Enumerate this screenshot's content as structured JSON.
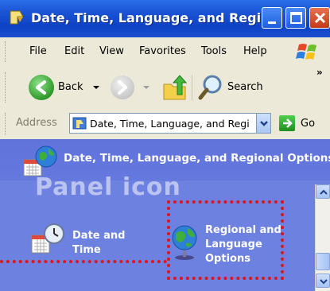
{
  "window": {
    "title": "Date, Time, Language, and Regi...",
    "controls": [
      "minimize",
      "maximize",
      "close"
    ]
  },
  "menu": {
    "items": [
      "File",
      "Edit",
      "View",
      "Favorites",
      "Tools",
      "Help"
    ]
  },
  "toolbar": {
    "back_label": "Back",
    "search_label": "Search"
  },
  "address": {
    "label": "Address",
    "value": "Date, Time, Language, and Regi",
    "go_label": "Go"
  },
  "content": {
    "header": "Date, Time, Language, and Regional Options",
    "section_heading": "Panel icon",
    "tasks": [
      {
        "label_line1": "Date and",
        "label_line2": "Time",
        "icon": "clock-calendar-icon"
      },
      {
        "label_line1": "Regional and",
        "label_line2": "Language",
        "label_line3": "Options",
        "icon": "globe-icon"
      }
    ]
  },
  "colors": {
    "titlebar": "#0e42c4",
    "content_bg": "#6d81e0",
    "annotation_red": "#e0141a"
  }
}
